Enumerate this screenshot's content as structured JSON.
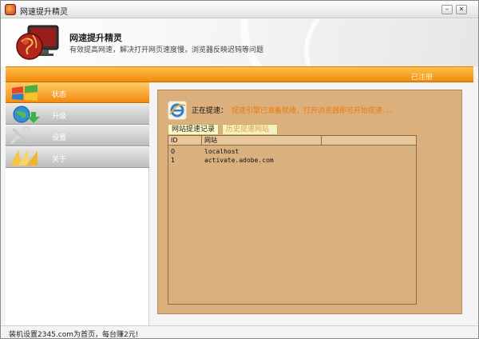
{
  "window": {
    "title": "网速提升精灵",
    "minimize_glyph": "–",
    "close_glyph": "✕"
  },
  "header": {
    "app_name": "网速提升精灵",
    "description": "有效提高网速，解决打开网页速度慢，浏览器反映迟钝等问题"
  },
  "top_bar": {
    "registered_label": "已注册"
  },
  "nav": {
    "items": [
      {
        "label": "状态",
        "icon": "windows-logo-icon",
        "active": true
      },
      {
        "label": "升级",
        "icon": "upgrade-globe-icon",
        "active": false
      },
      {
        "label": "设置",
        "icon": "wrench-settings-icon",
        "active": false
      },
      {
        "label": "关于",
        "icon": "sunburst-icon",
        "active": false
      }
    ]
  },
  "status": {
    "label": "正在提速：",
    "message": "提速引擎已准备就绪，打开浏览器即可开始提速．．．"
  },
  "tabs": [
    {
      "label": "网站提速记录",
      "active": true
    },
    {
      "label": "历史提速网站",
      "active": false
    }
  ],
  "table": {
    "columns": [
      "ID",
      "网站"
    ],
    "rows": [
      {
        "id": "0",
        "site": "localhost"
      },
      {
        "id": "1",
        "site": "activate.adobe.com"
      }
    ]
  },
  "footer": {
    "text": "装机设置2345.com为首页，每台赚2元!"
  },
  "colors": {
    "accent_orange": "#f28a10",
    "panel_tan": "#dbb07c",
    "status_orange": "#ee7a0a"
  }
}
